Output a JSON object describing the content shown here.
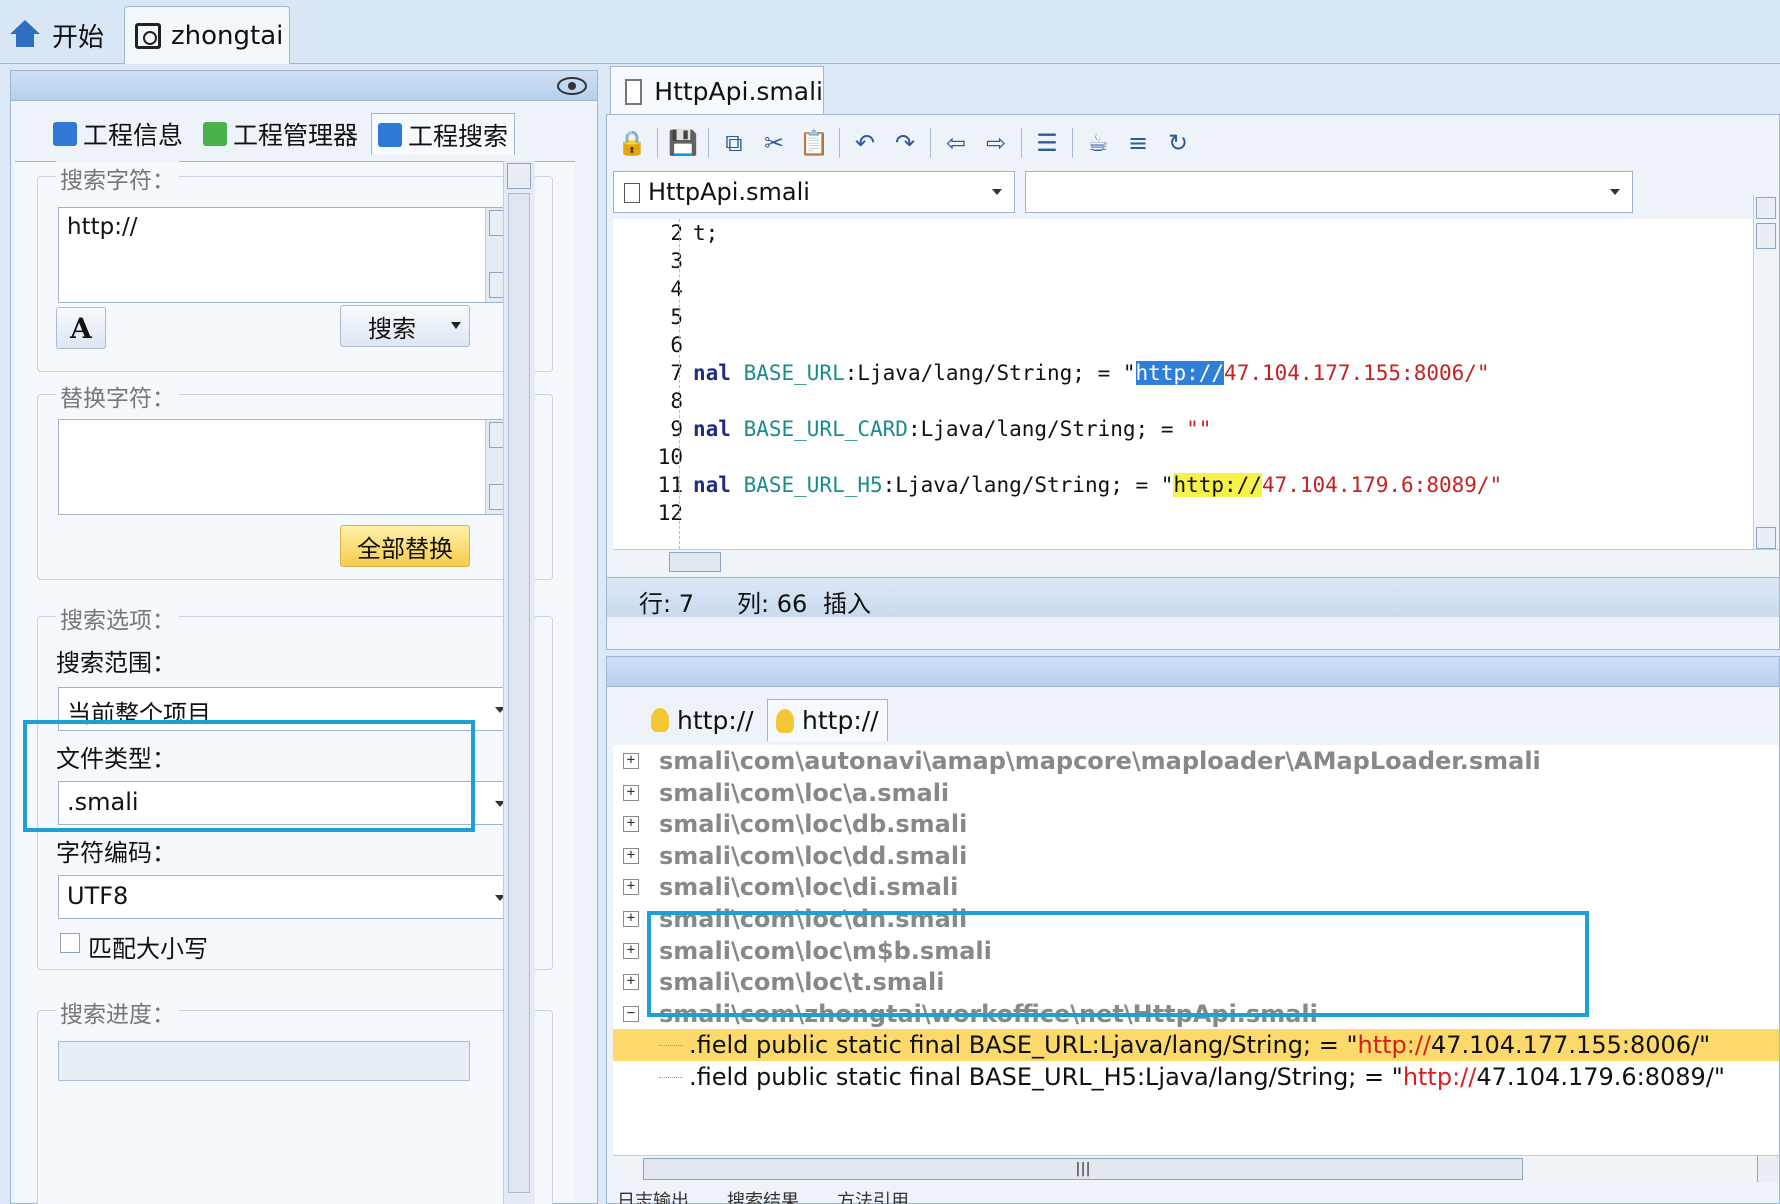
{
  "top_tabs": {
    "start": "开始",
    "project": "zhongtai"
  },
  "left_tabs": {
    "info": "工程信息",
    "manager": "工程管理器",
    "search": "工程搜索"
  },
  "search": {
    "label": "搜索字符：",
    "value": "http://",
    "search_button": "搜索",
    "font_button": "A"
  },
  "replace": {
    "label": "替换字符：",
    "value": "",
    "replace_all_button": "全部替换"
  },
  "options": {
    "label": "搜索选项：",
    "scope_label": "搜索范围：",
    "scope_value": "当前整个项目",
    "filetype_label": "文件类型：",
    "filetype_value": ".smali",
    "encoding_label": "字符编码：",
    "encoding_value": "UTF8",
    "match_case_label": "匹配大小写",
    "match_case_checked": false
  },
  "progress": {
    "label": "搜索进度："
  },
  "editor": {
    "file_tab": "HttpApi.smali",
    "file_combo": "HttpApi.smali",
    "member_combo": "",
    "lines": [
      {
        "n": "2",
        "t": "t;"
      },
      {
        "n": "3",
        "t": ""
      },
      {
        "n": "4",
        "t": ""
      },
      {
        "n": "5",
        "t": ""
      },
      {
        "n": "6",
        "t": ""
      },
      {
        "n": "7",
        "kw": "nal",
        "field": "BASE_URL",
        "rest": ":Ljava/lang/String; = \"",
        "match": "http://",
        "str": "47.104.177.155:8006/\"",
        "match_style": "sel"
      },
      {
        "n": "8",
        "t": ""
      },
      {
        "n": "9",
        "kw": "nal",
        "field": "BASE_URL_CARD",
        "rest": ":Ljava/lang/String; = ",
        "match": "",
        "str": "\"\"",
        "match_style": ""
      },
      {
        "n": "10",
        "t": ""
      },
      {
        "n": "11",
        "kw": "nal",
        "field": "BASE_URL_H5",
        "rest": ":Ljava/lang/String; = \"",
        "match": "http://",
        "str": "47.104.179.6:8089/\"",
        "match_style": "yel"
      },
      {
        "n": "12",
        "t": ""
      }
    ],
    "status": {
      "row": "行: 7",
      "col": "列: 66",
      "mode": "插入"
    }
  },
  "results": {
    "tabs": [
      "http://",
      "http://"
    ],
    "files": [
      "smali\\com\\autonavi\\amap\\mapcore\\maploader\\AMapLoader.smali",
      "smali\\com\\loc\\a.smali",
      "smali\\com\\loc\\db.smali",
      "smali\\com\\loc\\dd.smali",
      "smali\\com\\loc\\di.smali",
      "smali\\com\\loc\\dn.smali",
      "smali\\com\\loc\\m$b.smali",
      "smali\\com\\loc\\t.smali",
      "smali\\com\\zhongtai\\workoffice\\net\\HttpApi.smali"
    ],
    "matches": [
      {
        "pre": ".field public static final BASE_URL:Ljava/lang/String; = \"",
        "url": "http://",
        "post": "47.104.177.155:8006/\""
      },
      {
        "pre": ".field public static final BASE_URL_H5:Ljava/lang/String; = \"",
        "url": "http://",
        "post": "47.104.179.6:8089/\""
      }
    ],
    "bottom_tabs": [
      "日志输出",
      "搜索结果",
      "方法引用"
    ]
  },
  "colors": {
    "highlight_box": "#1fa0d4",
    "selection": "#2f7fd8",
    "match_yellow": "#f7f24a",
    "url_red": "#d62020"
  }
}
